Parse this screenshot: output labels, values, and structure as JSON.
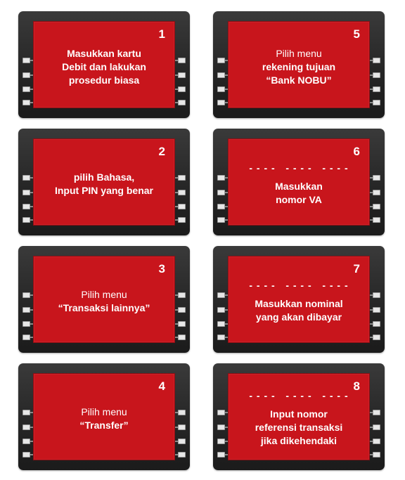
{
  "colors": {
    "screen": "#c8151c",
    "frame": "#262626",
    "text": "#ffffff"
  },
  "steps": [
    {
      "number": "1",
      "lines": [
        {
          "text": "Masukkan kartu",
          "bold": true
        },
        {
          "text": "Debit dan lakukan",
          "bold": true
        },
        {
          "text": "prosedur biasa",
          "bold": true
        }
      ]
    },
    {
      "number": "2",
      "lines": [
        {
          "text": "pilih Bahasa,",
          "bold": true
        },
        {
          "text": "Input PIN yang benar",
          "bold": true
        }
      ]
    },
    {
      "number": "3",
      "lines": [
        {
          "text": "Pilih menu",
          "bold": false
        },
        {
          "text": "“Transaksi lainnya”",
          "bold": true
        }
      ]
    },
    {
      "number": "4",
      "lines": [
        {
          "text": "Pilih menu",
          "bold": false
        },
        {
          "text": "“Transfer”",
          "bold": true
        }
      ]
    },
    {
      "number": "5",
      "lines": [
        {
          "text": "Pilih menu",
          "bold": false
        },
        {
          "text": "rekening tujuan",
          "bold": true
        },
        {
          "text": "“Bank NOBU”",
          "bold": true
        }
      ]
    },
    {
      "number": "6",
      "dashes": "- - - -   - - - -   - - - -",
      "lines": [
        {
          "text": "Masukkan",
          "bold": true
        },
        {
          "text": "nomor VA",
          "bold": true
        }
      ]
    },
    {
      "number": "7",
      "dashes": "- - - -   - - - -   - - - -",
      "lines": [
        {
          "text": "Masukkan nominal",
          "bold": true
        },
        {
          "text": "yang akan dibayar",
          "bold": true
        }
      ]
    },
    {
      "number": "8",
      "dashes": "- - - -   - - - -   - - - -",
      "lines": [
        {
          "text": "Input nomor",
          "bold": true
        },
        {
          "text": "referensi transaksi",
          "bold": true
        },
        {
          "text": "jika dikehendaki",
          "bold": true
        }
      ]
    }
  ]
}
